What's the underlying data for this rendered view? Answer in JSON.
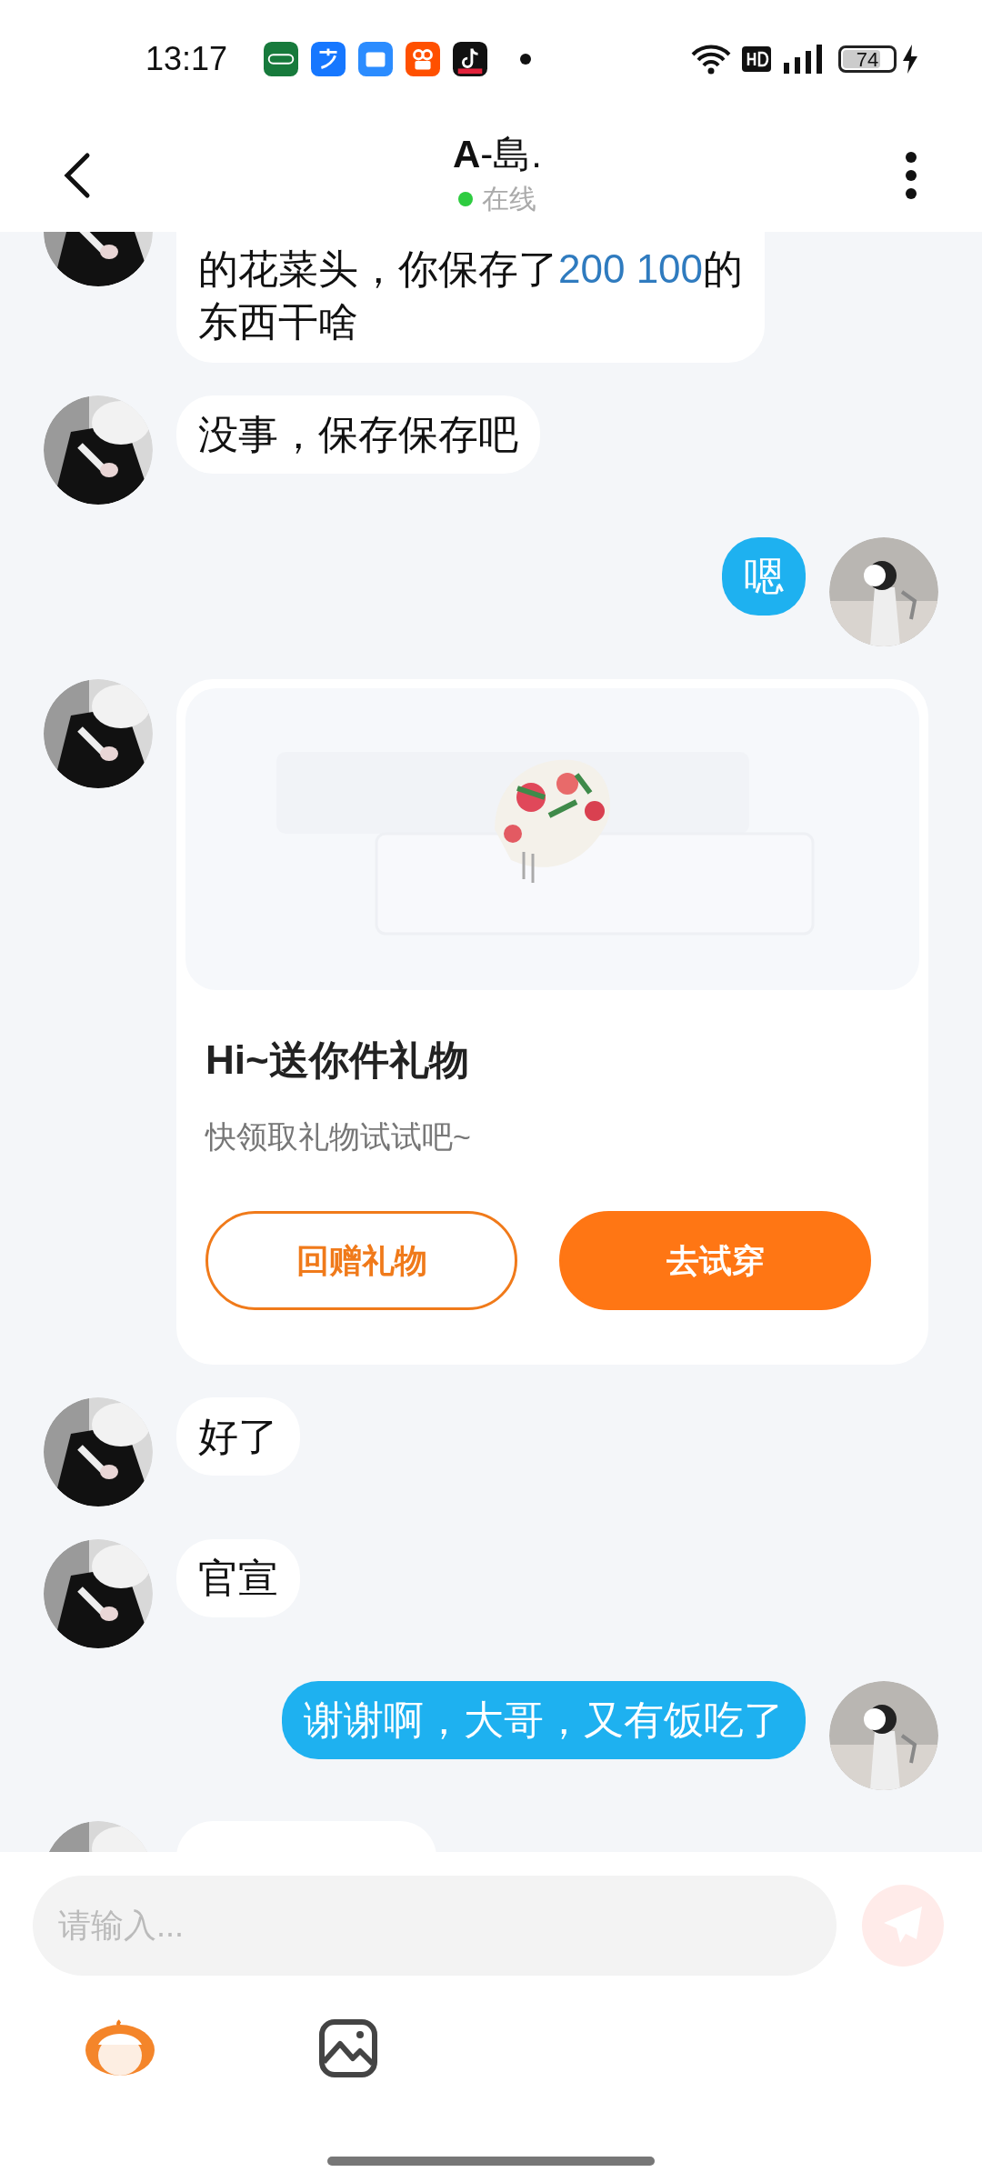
{
  "status_bar": {
    "time": "13:17",
    "battery": "74",
    "charging": true
  },
  "header": {
    "title": "**A**-島.",
    "status": "在线",
    "online": true
  },
  "messages": [
    {
      "kind": "clipped",
      "outgoing": false,
      "lines": [
        [
          {
            "text": "的花菜头，你保存了",
            "link": false
          },
          {
            "text": "200 100",
            "link": true
          },
          {
            "text": "的",
            "link": false
          }
        ],
        [
          {
            "text": "东西干啥",
            "link": false
          }
        ]
      ]
    },
    {
      "kind": "text",
      "outgoing": false,
      "text": "没事，保存保存吧"
    },
    {
      "kind": "text",
      "outgoing": true,
      "text": "嗯"
    },
    {
      "kind": "gift",
      "outgoing": false,
      "title": "Hi~送你件礼物",
      "subtitle": "快领取礼物试试吧~",
      "buttons": [
        {
          "label": "回赠礼物",
          "kind": "outline"
        },
        {
          "label": "去试穿",
          "kind": "filled"
        }
      ]
    },
    {
      "kind": "text",
      "outgoing": false,
      "text": "好了"
    },
    {
      "kind": "text",
      "outgoing": false,
      "text": "官宣"
    },
    {
      "kind": "text",
      "outgoing": true,
      "text": "谢谢啊，大哥，又有饭吃了"
    },
    {
      "kind": "hidden",
      "outgoing": false
    }
  ],
  "composer": {
    "placeholder": "请输入...",
    "send_disabled": true
  }
}
